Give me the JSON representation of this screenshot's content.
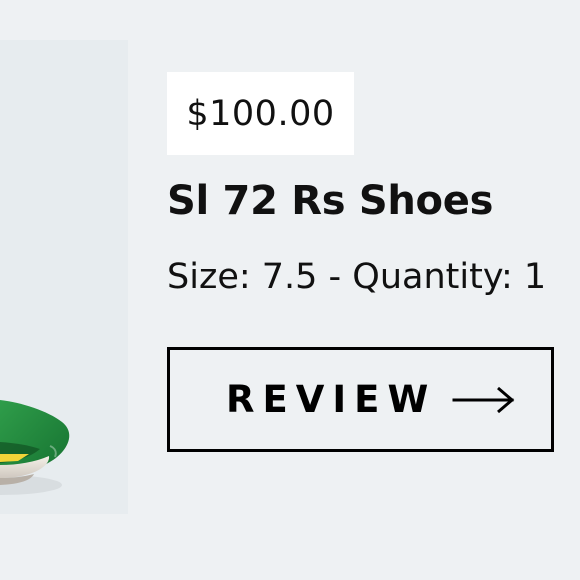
{
  "product": {
    "price": "$100.00",
    "title": "Sl 72 Rs Shoes",
    "meta": "Size: 7.5 - Quantity: 1",
    "review_label": "REVIEW"
  },
  "icons": {
    "review_arrow": "right-arrow-icon"
  },
  "colors": {
    "background": "#eef1f3",
    "shoe_green": "#1f8b3a",
    "shoe_yellow": "#f2d438"
  }
}
